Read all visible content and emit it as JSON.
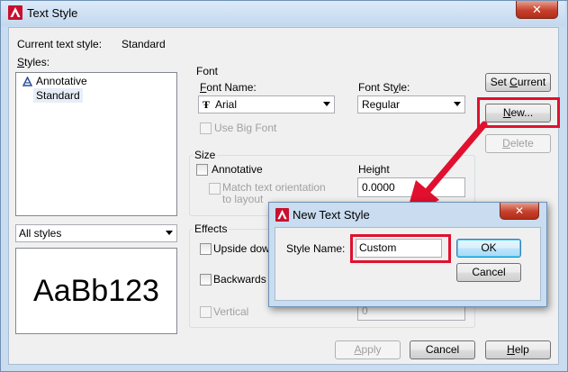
{
  "window": {
    "title": "Text Style",
    "close_glyph": "✕",
    "icon": "autocad-logo-icon"
  },
  "current_style": {
    "label": "Current text style:",
    "value": "Standard"
  },
  "styles": {
    "label": "Styles:",
    "items": [
      {
        "label": "Annotative",
        "icon": "annotative-icon",
        "selected": false
      },
      {
        "label": "Standard",
        "selected": true
      }
    ],
    "filter_value": "All styles"
  },
  "preview": {
    "text": "AaBb123"
  },
  "font": {
    "group_label": "Font",
    "name_label": "Font Name:",
    "name_value": "Arial",
    "name_icon": "truetype-font-icon",
    "style_label": "Font Style:",
    "style_value": "Regular",
    "big_font_label": "Use Big Font"
  },
  "size": {
    "group_label": "Size",
    "annotative_label": "Annotative",
    "match_orientation_label": "Match text orientation to layout",
    "height_label": "Height",
    "height_value": "0.0000"
  },
  "effects": {
    "group_label": "Effects",
    "upside_down_label": "Upside down",
    "backwards_label": "Backwards",
    "vertical_label": "Vertical",
    "oblique_value": "0"
  },
  "buttons": {
    "set_current": "Set Current",
    "new": "New...",
    "delete": "Delete",
    "apply": "Apply",
    "cancel": "Cancel",
    "help": "Help"
  },
  "new_style_dialog": {
    "title": "New Text Style",
    "close_glyph": "✕",
    "style_name_label": "Style Name:",
    "style_name_value": "Custom",
    "ok": "OK",
    "cancel": "Cancel"
  },
  "colors": {
    "highlight": "#e0102e",
    "window_frame": "#c9dcf0",
    "selection": "#e8eef8"
  }
}
